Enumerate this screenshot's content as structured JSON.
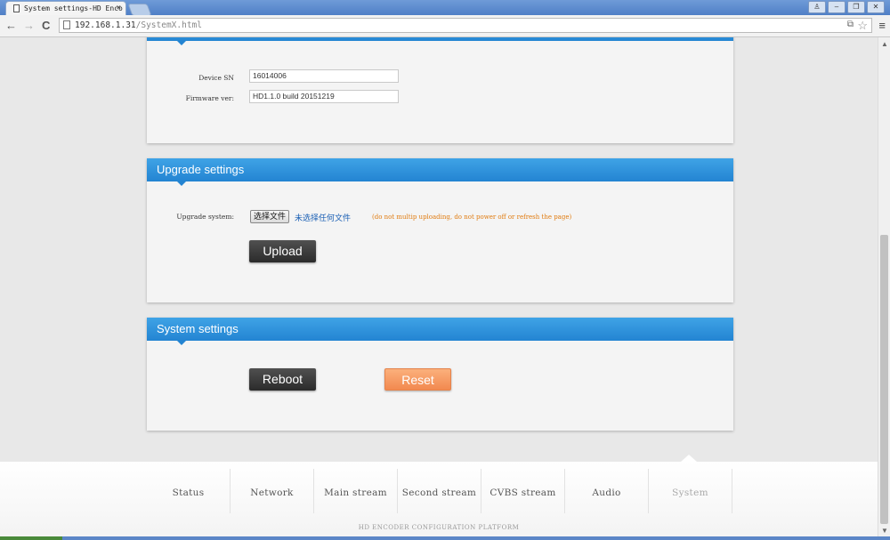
{
  "browser": {
    "tab_title": "System settings-HD Enco",
    "tab_close": "×",
    "url_host": "192.168.1.31",
    "url_path": "/SystemX.html",
    "back": "←",
    "forward": "→",
    "reload": "C",
    "star": "☆",
    "translate": "⧉",
    "menu": "≡",
    "window_buttons": [
      "♙",
      "–",
      "❐",
      "✕"
    ]
  },
  "device_info": {
    "sn_label": "Device SN",
    "sn_value": "16014006",
    "firmware_label": "Firmware ver:",
    "firmware_value": "HD1.1.0 build 20151219"
  },
  "upgrade": {
    "title": "Upgrade settings",
    "system_label": "Upgrade system:",
    "choose_file": "选择文件",
    "no_file": "未选择任何文件",
    "warning": "(do not multip uploading, do not power off or refresh the page)",
    "upload_label": "Upload"
  },
  "system": {
    "title": "System settings",
    "reboot_label": "Reboot",
    "reset_label": "Reset"
  },
  "bottom_nav": {
    "items": [
      "Status",
      "Network",
      "Main stream",
      "Second stream",
      "CVBS stream",
      "Audio",
      "System"
    ],
    "active": "System",
    "platform": "HD ENCODER CONFIGURATION PLATFORM"
  },
  "colors": {
    "header_blue": "#2384d2",
    "reset_orange": "#f2894f",
    "warning_orange": "#e07b0f",
    "button_dark": "#2b2b2b"
  }
}
